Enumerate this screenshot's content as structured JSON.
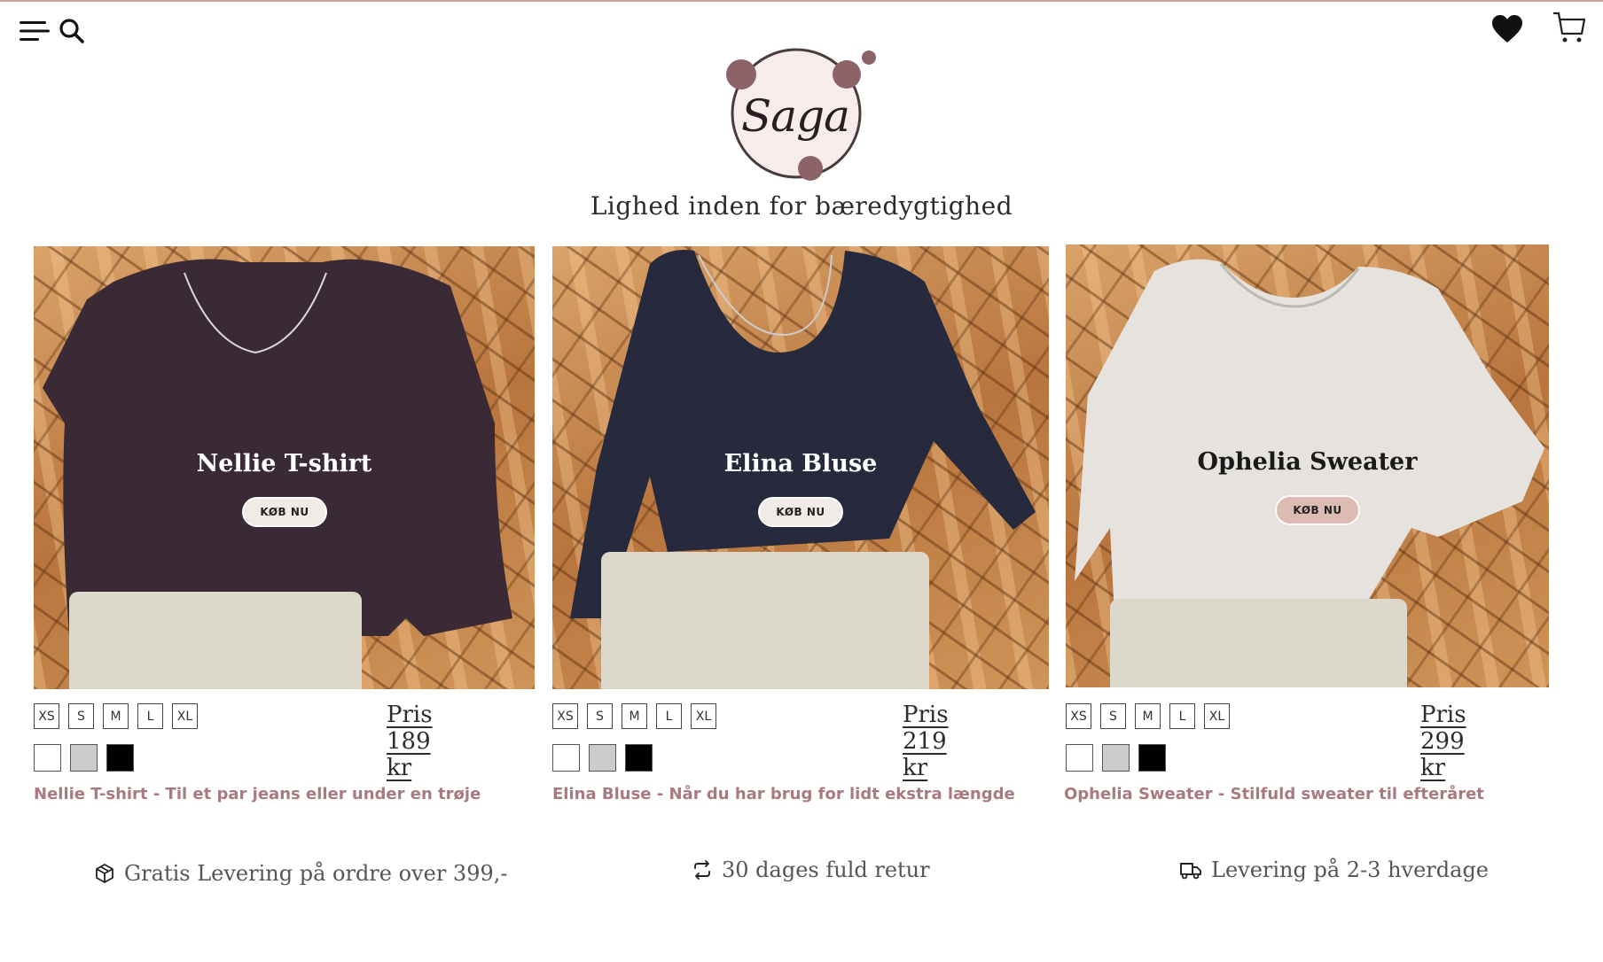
{
  "brand": {
    "logo_text": "Saga",
    "tagline": "Lighed inden for bæredygtighed"
  },
  "header": {
    "icons": [
      "menu-icon",
      "search-icon",
      "heart-icon",
      "cart-icon"
    ]
  },
  "sizes": [
    "XS",
    "S",
    "M",
    "L",
    "XL"
  ],
  "colors": [
    "#ffffff",
    "#cccccc",
    "#000000"
  ],
  "products": [
    {
      "title": "Nellie T-shirt",
      "button": "KØB NU",
      "price": "Pris 189 kr",
      "description": "Nellie T-shirt - Til et par jeans eller under en trøje",
      "title_color": "#ffffff",
      "button_bg": "#f1ebe6"
    },
    {
      "title": "Elina Bluse",
      "button": "KØB NU",
      "price": "Pris 219 kr",
      "description": "Elina Bluse - Når du har brug for lidt ekstra længde",
      "title_color": "#ffffff",
      "button_bg": "#f1ebe6"
    },
    {
      "title": "Ophelia Sweater",
      "button": "KØB NU",
      "price": "Pris 299 kr",
      "description": "Ophelia Sweater - Stilfuld sweater til efteråret",
      "title_color": "#1a1a1a",
      "button_bg": "#dcbcb2"
    }
  ],
  "features": [
    {
      "icon": "box-icon",
      "text": "Gratis Levering på ordre over 399,-"
    },
    {
      "icon": "return-icon",
      "text": "30 dages fuld retur"
    },
    {
      "icon": "truck-icon",
      "text": "Levering på 2-3 hverdage"
    }
  ],
  "theme": {
    "accent": "#a87a80",
    "logo_dots": "#8c6468",
    "logo_bg": "#f7ecea"
  }
}
